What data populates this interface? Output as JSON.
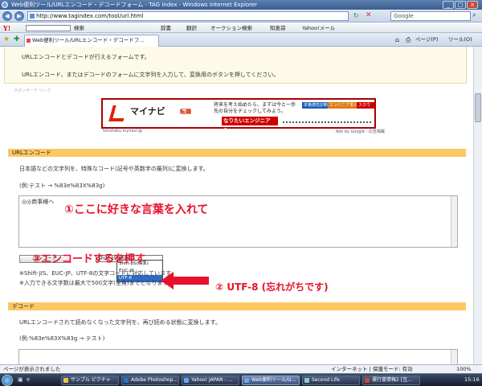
{
  "window": {
    "title": "Web便利ツール/URLエンコード・デコードフォーム - TAG index - Windows Internet Explorer",
    "controls": {
      "minimize": "_",
      "maximize": "□",
      "close": "×"
    }
  },
  "address_bar": {
    "url": "http://www.tagindex.com/tool/url.html",
    "search_placeholder": "Google"
  },
  "yahoo_toolbar": {
    "logo": "Y!",
    "items": [
      "検索",
      "辞書",
      "翻訳",
      "オークション検索",
      "知恵袋",
      "Yahoo!メール"
    ]
  },
  "tabs": [
    {
      "label": "Web便利ツール/URLエンコード・デコードフ..."
    }
  ],
  "command_bar": {
    "page": "ページ(P)",
    "tools": "ツール(O)"
  },
  "content": {
    "intro_lines": [
      "URLエンコードとデコードが行えるフォームです。",
      "URLエンコード、またはデコードのフォームに文字列を入力して、変換用のボタンを押してください。"
    ],
    "sponsor_label": "スポンサード リンク",
    "ad": {
      "brand": "マイナビ",
      "brand_sub": "転職",
      "copy": "将来を考え始めたら、まずは今と一歩先の自分をチェックしてみよう。",
      "tag1": "本格適性診断",
      "tag2": "エンジニア求人特集",
      "tag3": "スカウト",
      "slogan": "なりたいエンジニアへ。",
      "link": "tenshoku.mynavi.jp",
      "ads_by": "Ads by Google - 広告掲載"
    },
    "encode": {
      "heading": "URLエンコード",
      "description": "日本語などの文字列を、特殊なコード(記号や英数字の羅列)に変換します。",
      "example": "(例:テスト → %83e%83X%83g)",
      "textarea_value": "◎◎商事様へ",
      "button_label": "エンコード",
      "charset_selected": "Shift-JIS(標準)",
      "charset_options": [
        "Shift-JIS(標準)",
        "EUC-JP",
        "UTF-8"
      ],
      "charset_highlighted": "UTF-8",
      "note1": "※Shift-JIS、EUC-JP、UTF-8の文字コードに対応しています。",
      "note2": "※入力できる文字数は最大で500文字(全角)までとなります。"
    },
    "decode": {
      "heading": "デコード",
      "description": "URLエンコードされて読めなくなった文字列を、再び読める状態に変換します。",
      "example": "(例:%83e%83X%83g → テスト)"
    },
    "annotations": {
      "step1": "①ここに好きな言葉を入れて",
      "step2": "② UTF-8 (忘れがちです)",
      "step3": "③エンコードするを押す"
    }
  },
  "status_bar": {
    "text": "ページが表示されました",
    "zone": "インターネット | 保護モード: 有効",
    "zoom": "100%"
  },
  "taskbar": {
    "buttons": [
      "サンプル ピクチャ",
      "Adobe Photoshop...",
      "Yahoo! JAPAN - ...",
      "Web便利ツール/U...",
      "Second Life",
      "運行書情報2 [互..."
    ],
    "clock": "15:16"
  },
  "colors": {
    "section_header": "#fdc864",
    "annotation_red": "#e8112d",
    "ad_red": "#cc0000"
  }
}
